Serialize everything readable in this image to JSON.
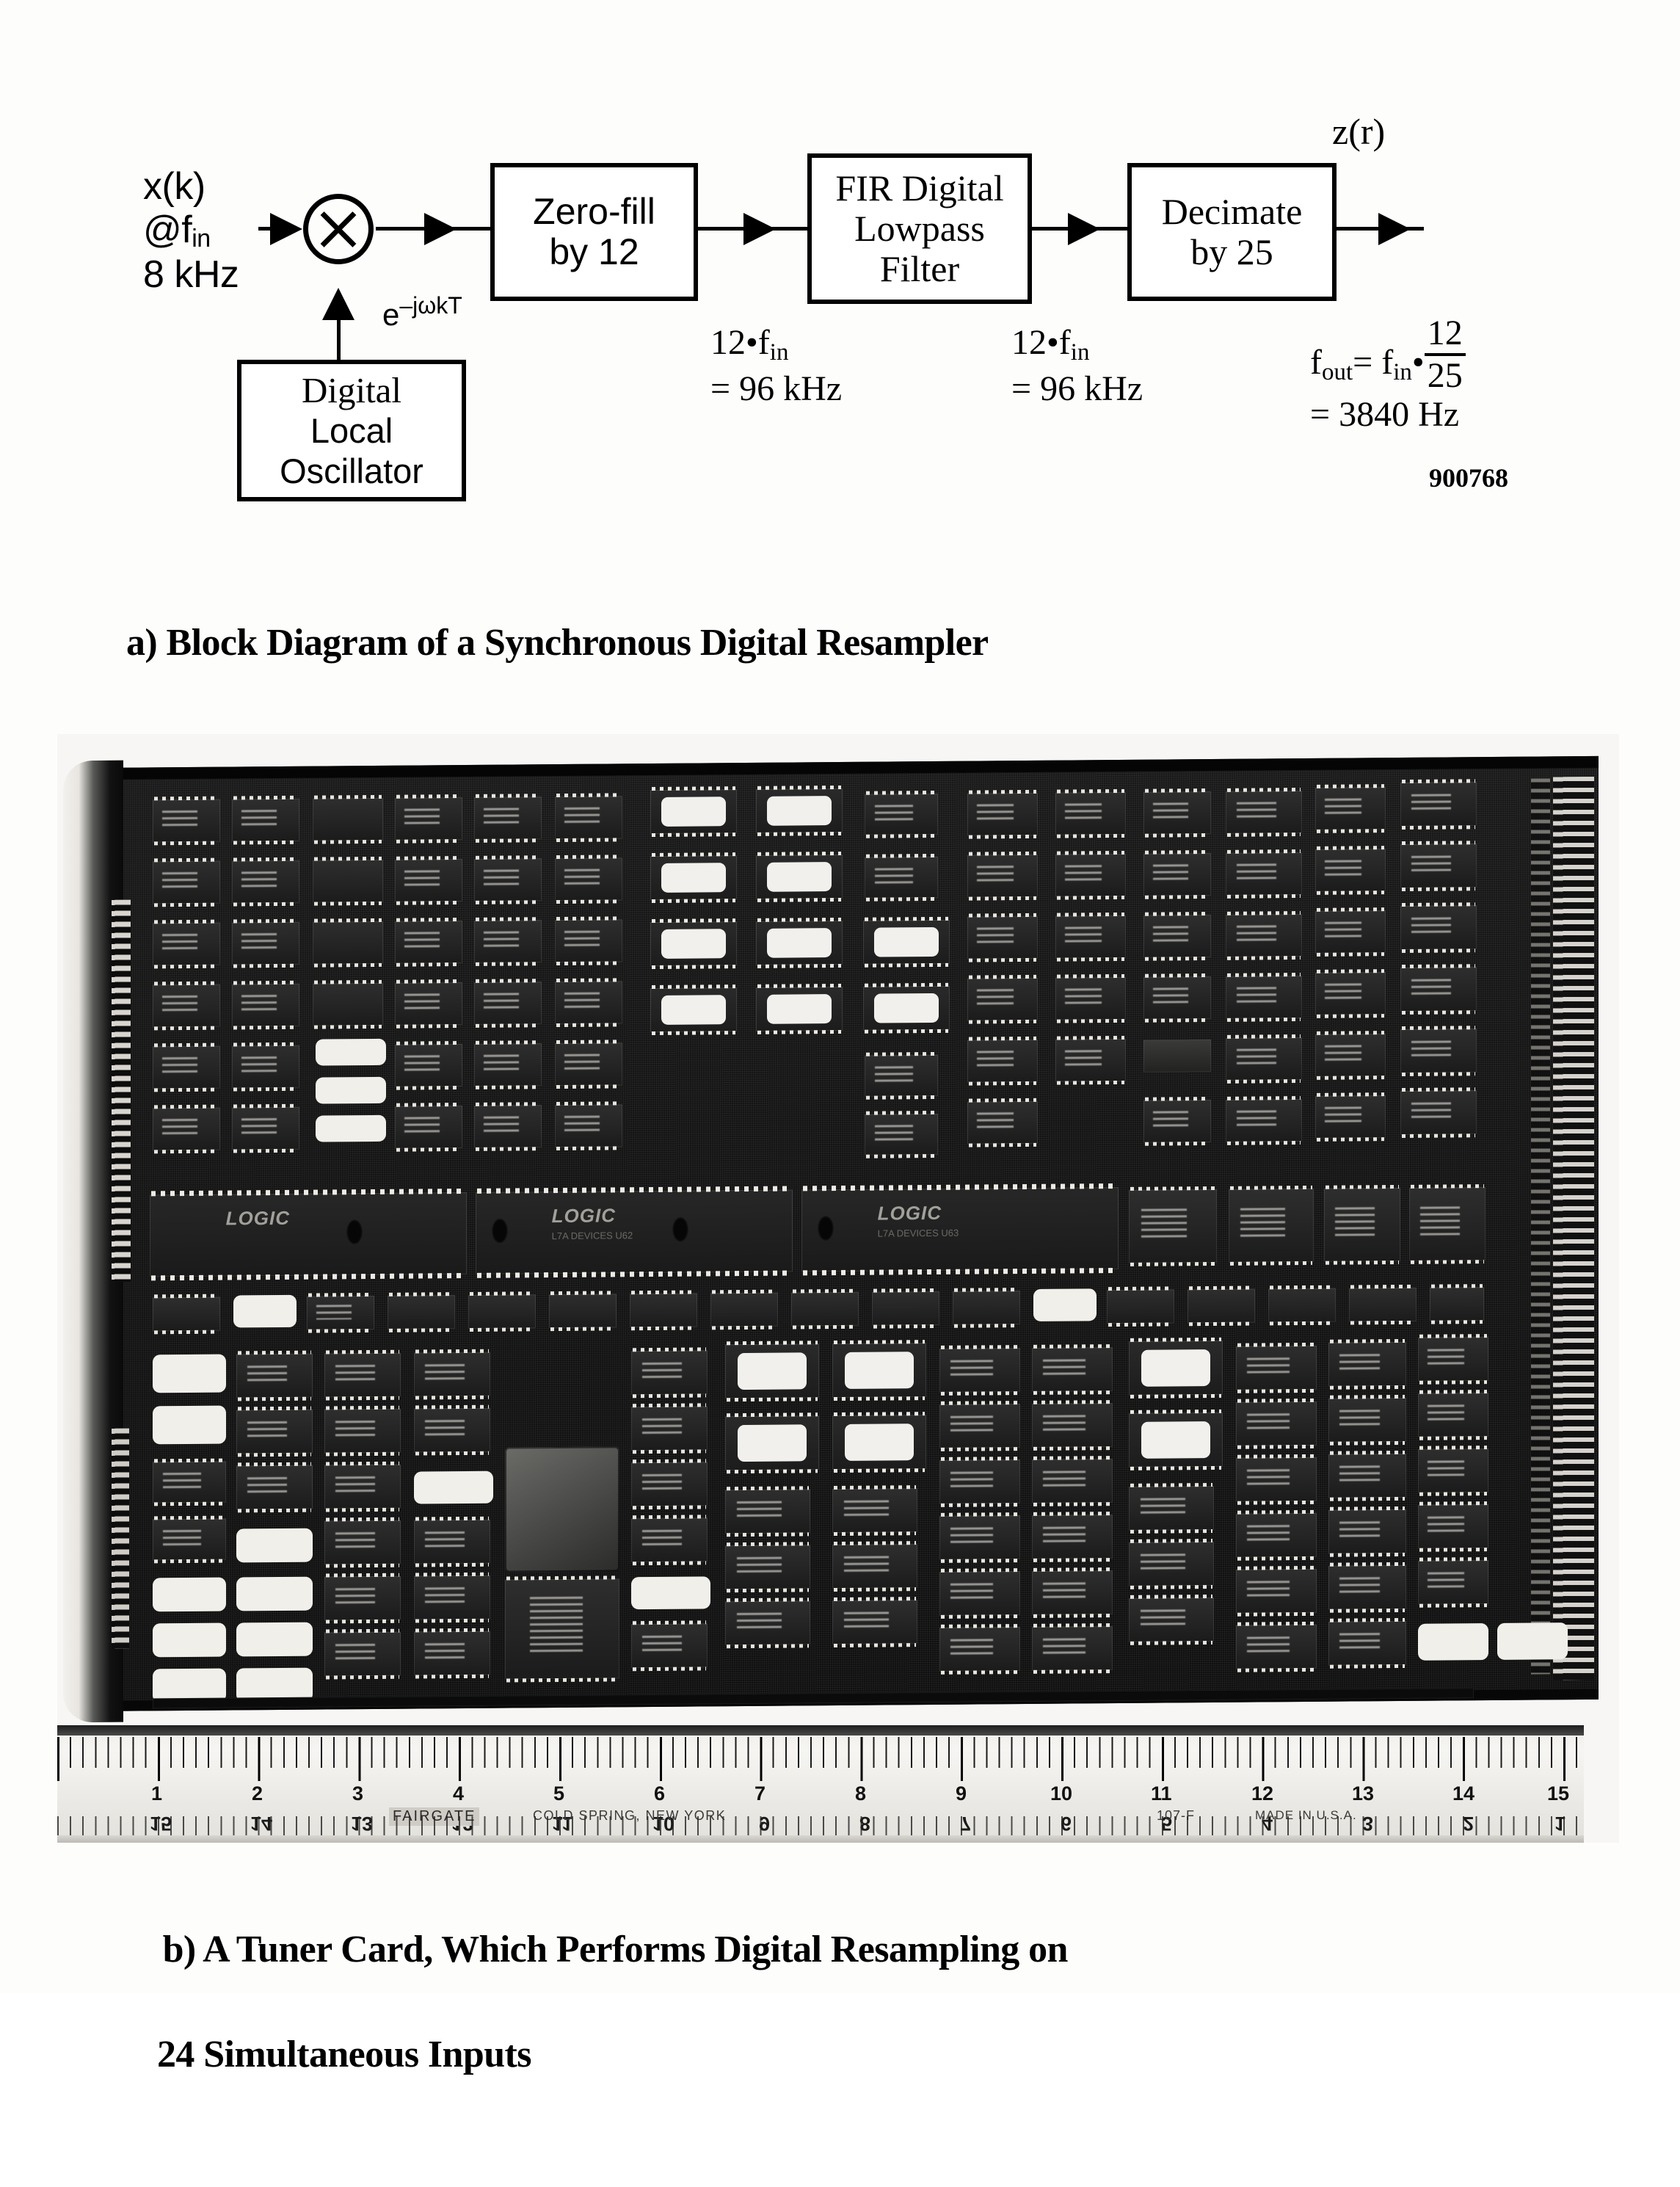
{
  "figure": {
    "number": "900768"
  },
  "block_diagram": {
    "input_signal": "x(k)",
    "input_rate_at": "@f",
    "input_rate_sub": "in",
    "input_rate_value": "8 kHz",
    "mixer_symbol": "X",
    "local_oscillator_exponent_base": "e",
    "local_oscillator_exponent_sup": "–jωkT",
    "blocks": [
      {
        "id": "zero-fill",
        "line1": "Zero-fill",
        "line2": "by 12"
      },
      {
        "id": "fir-filter",
        "line1": "FIR Digital",
        "line2": "Lowpass",
        "line3": "Filter"
      },
      {
        "id": "decimate",
        "line1": "Decimate",
        "line2": "by 25"
      }
    ],
    "oscillator_block": {
      "line1": "Digital",
      "line2": "Local",
      "line3": "Oscillator"
    },
    "output_signal": "z(r)",
    "rate_labels": [
      {
        "id": "after-zero-fill",
        "expr": "12•f",
        "sub": "in",
        "value": "= 96 kHz"
      },
      {
        "id": "after-fir",
        "expr": "12•f",
        "sub": "in",
        "value": "= 96 kHz"
      }
    ],
    "output_rate": {
      "lhs": "f",
      "lhs_sub": "out",
      "eq": "= f",
      "rhs_sub": "in",
      "dot": "•",
      "frac_num": "12",
      "frac_den": "25",
      "value": "= 3840 Hz"
    }
  },
  "captions": {
    "a": "a) Block Diagram of a Synchronous Digital Resampler",
    "b_line1": "b) A Tuner Card, Which Performs Digital Resampling on",
    "b_line2": "24 Simultaneous Inputs"
  },
  "photo": {
    "logic_modules": [
      {
        "label": "LOGIC",
        "sub": ""
      },
      {
        "label": "LOGIC",
        "sub": "L7A\nDEVICES\nU62"
      },
      {
        "label": "LOGIC",
        "sub": "L7A\nDEVICES\nU63"
      }
    ]
  },
  "ruler": {
    "top_numbers": [
      "1",
      "2",
      "3",
      "4",
      "5",
      "6",
      "7",
      "8",
      "9",
      "10",
      "11",
      "12",
      "13",
      "14",
      "15"
    ],
    "bottom_numbers": [
      "15",
      "14",
      "13",
      "12",
      "11",
      "10",
      "9",
      "8",
      "7",
      "6",
      "5",
      "4",
      "3",
      "2",
      "1"
    ],
    "brand": "FAIRGATE",
    "city": "COLD SPRING, NEW YORK",
    "model": "107-F",
    "made_in": "MADE IN U.S.A."
  },
  "colors": {
    "ink": "#000000",
    "paper": "#fdfdfc",
    "board": "#141414",
    "silkscreen": "#f1efea"
  }
}
